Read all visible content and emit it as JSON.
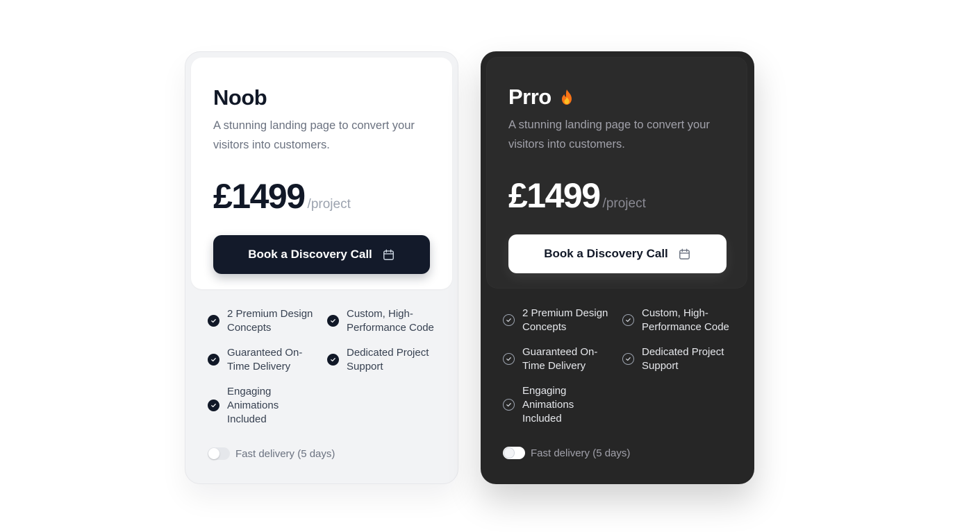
{
  "plans": [
    {
      "title": "Noob",
      "description": "A stunning landing page to convert your visitors into customers.",
      "price": "£1499",
      "price_suffix": "/project",
      "cta_label": "Book a Discovery Call",
      "features": [
        "2 Premium Design Concepts",
        "Custom, High-Performance Code",
        "Guaranteed On-Time Delivery",
        "Dedicated Project Support",
        "Engaging Animations Included"
      ],
      "toggle_label": "Fast delivery (5 days)",
      "toggle_on": false,
      "theme": "light"
    },
    {
      "title": "Prro",
      "title_icon": "flame-icon",
      "description": "A stunning landing page to convert your visitors into customers.",
      "price": "£1499",
      "price_suffix": "/project",
      "cta_label": "Book a Discovery Call",
      "features": [
        "2 Premium Design Concepts",
        "Custom, High-Performance Code",
        "Guaranteed On-Time Delivery",
        "Dedicated Project Support",
        "Engaging Animations Included"
      ],
      "toggle_label": "Fast delivery (5 days)",
      "toggle_on": false,
      "theme": "dark"
    }
  ],
  "colors": {
    "dark_button": "#131a2a",
    "dark_card": "#262626",
    "light_card": "#f2f3f5",
    "flame_outer": "#f97316",
    "flame_inner": "#fbbf24"
  }
}
